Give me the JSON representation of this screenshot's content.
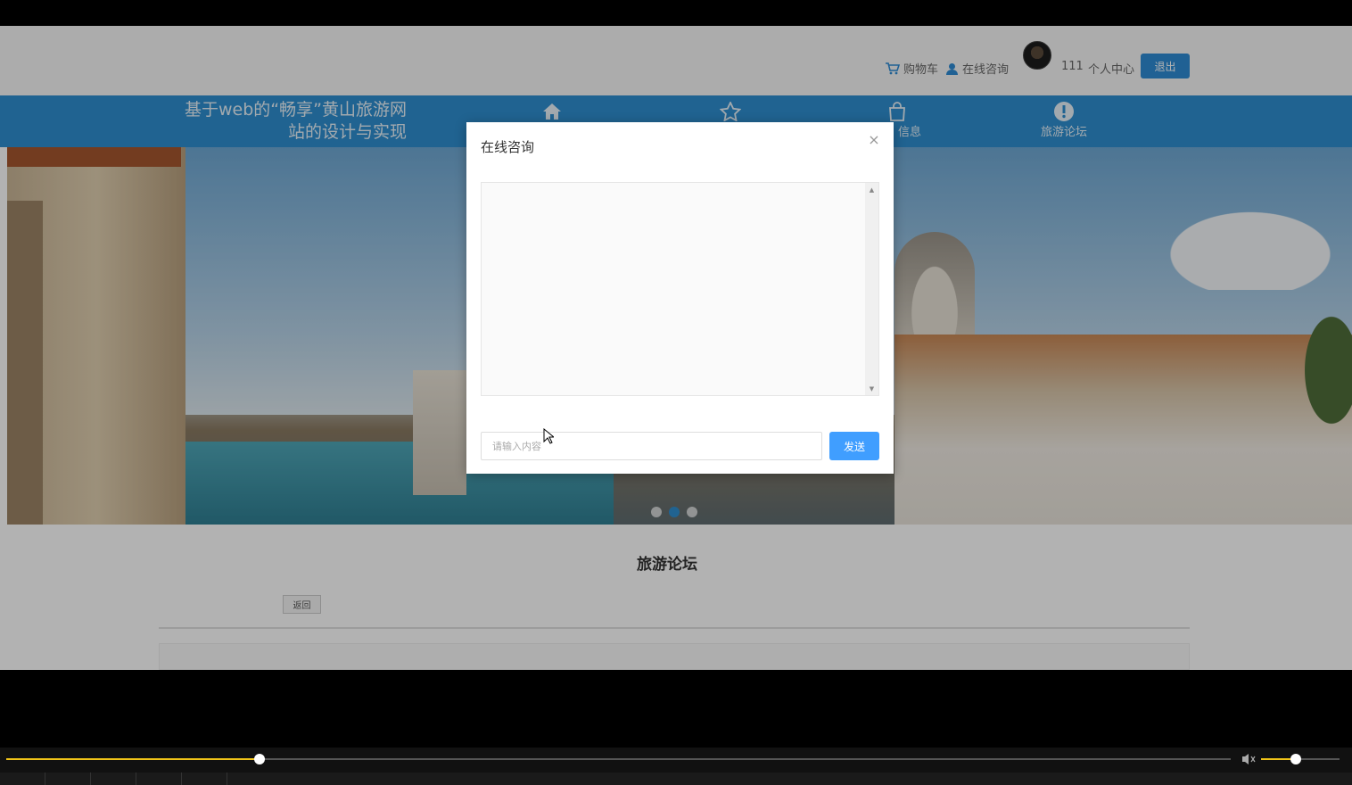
{
  "topbar": {
    "cart_label": "购物车",
    "consult_label": "在线咨询",
    "user_id": "111",
    "user_center_label": "个人中心",
    "logout_label": "退出"
  },
  "navbar": {
    "brand_line1": "基于web的“畅享”黄山旅游网",
    "brand_line2": "站的设计与实现",
    "items": [
      {
        "label": "",
        "icon": "home-icon"
      },
      {
        "label": "",
        "icon": "star-icon"
      },
      {
        "label": "信息",
        "icon": "bag-icon"
      },
      {
        "label": "旅游论坛",
        "icon": "exclamation-icon"
      }
    ]
  },
  "banner": {
    "slide_count": 3,
    "active_slide": 2
  },
  "content": {
    "section_title": "旅游论坛",
    "back_label": "返回"
  },
  "modal": {
    "title": "在线咨询",
    "close_symbol": "×",
    "input_placeholder": "请输入内容",
    "send_label": "发送"
  },
  "player": {
    "progress": 0.207,
    "volume": 0.44
  },
  "colors": {
    "nav_blue": "#2e8fd0",
    "send_blue": "#409eff",
    "progress_yellow": "#f0c419"
  }
}
